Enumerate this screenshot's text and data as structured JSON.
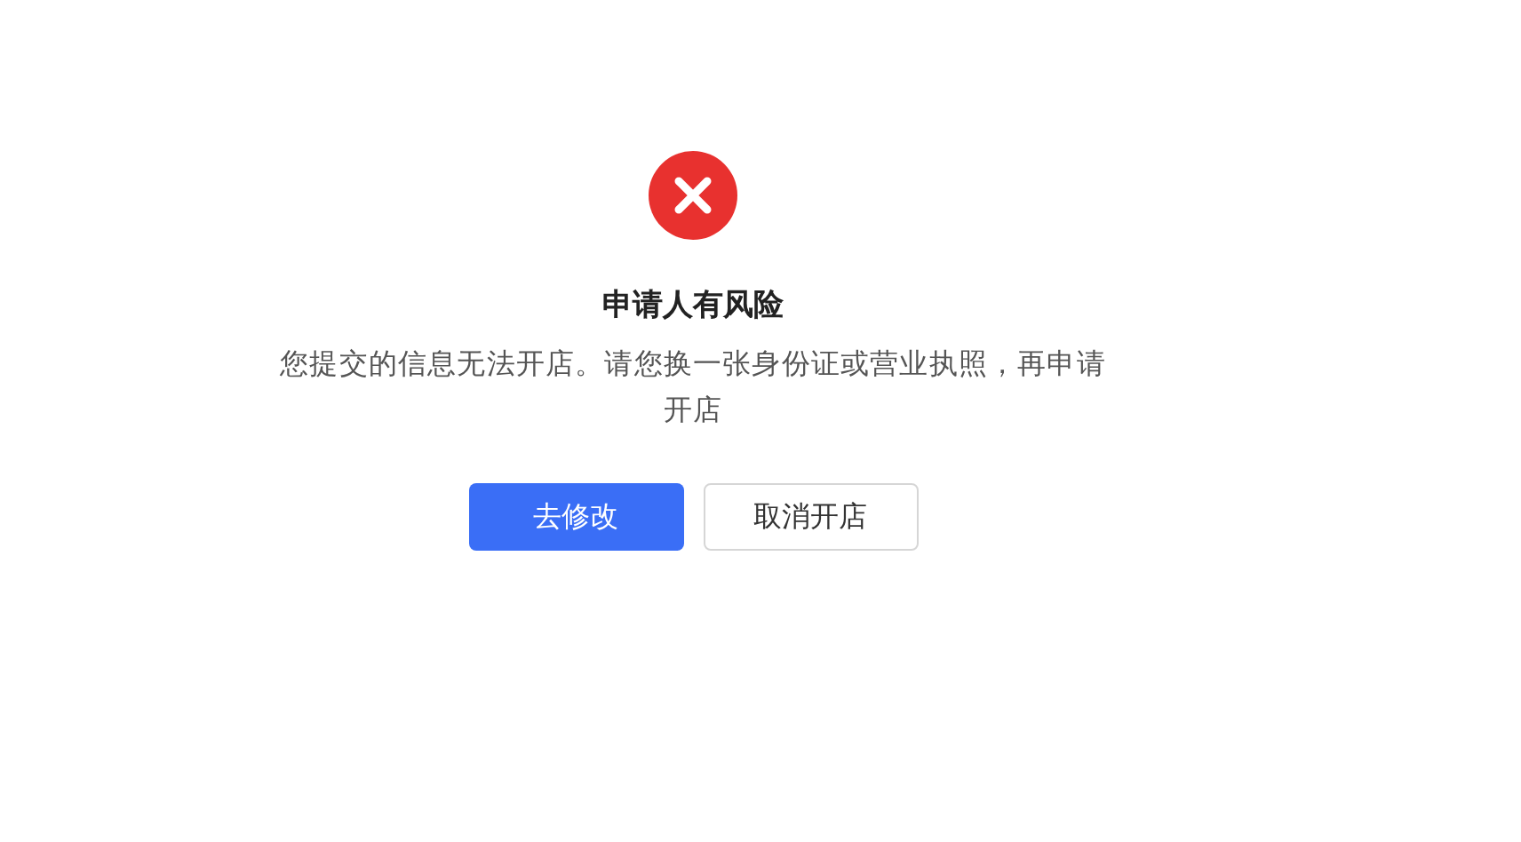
{
  "result": {
    "kind": "error",
    "title": "申请人有风险",
    "description": "您提交的信息无法开店。请您换一张身份证或营业执照，再申请开店",
    "buttons": [
      {
        "label": "去修改",
        "kind": "primary"
      },
      {
        "label": "取消开店",
        "kind": "default"
      }
    ]
  }
}
